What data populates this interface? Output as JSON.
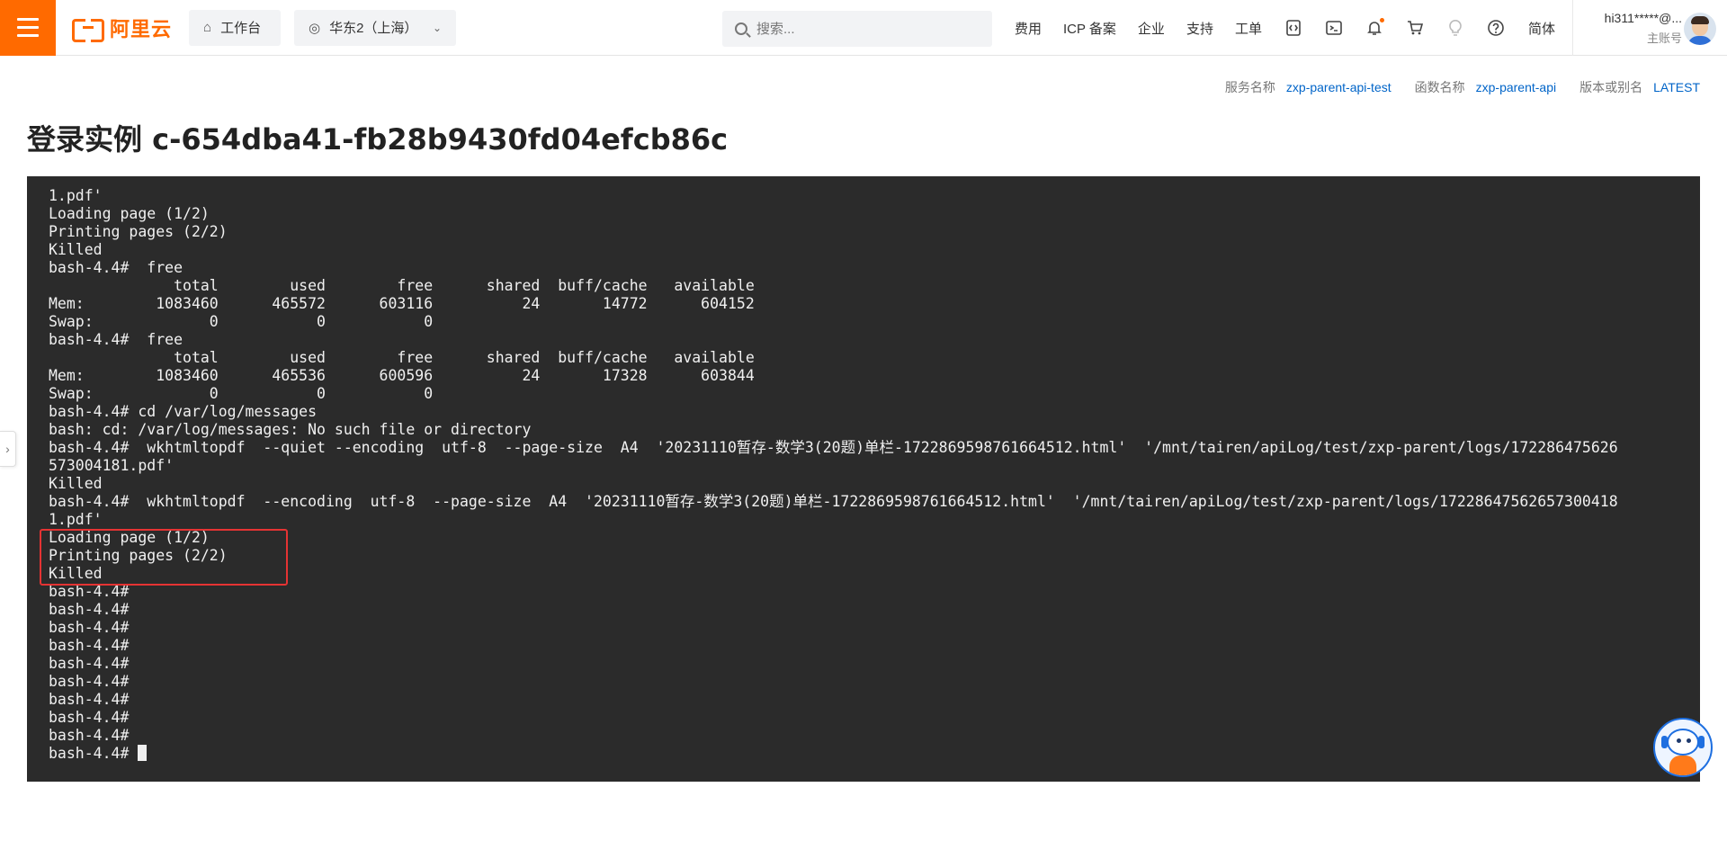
{
  "topbar": {
    "logo_text": "阿里云",
    "workbench_label": "工作台",
    "region_label": "华东2（上海）",
    "search_placeholder": "搜索...",
    "links": [
      "费用",
      "ICP 备案",
      "企业",
      "支持",
      "工单"
    ],
    "icons": [
      "code-icon",
      "terminal-icon",
      "bell-icon",
      "cart-icon",
      "lightbulb-icon",
      "help-icon"
    ],
    "language": "简体",
    "account_email": "hi311*****@...",
    "account_role": "主账号",
    "accent_color": "#ff6a00"
  },
  "meta": {
    "service_label": "服务名称",
    "service_value": "zxp-parent-api-test",
    "function_label": "函数名称",
    "function_value": "zxp-parent-api",
    "version_label": "版本或别名",
    "version_value": "LATEST"
  },
  "page_title": "登录实例 c-654dba41-fb28b9430fd04efcb86c",
  "terminal": {
    "lines": [
      "1.pdf'",
      "Loading page (1/2)",
      "Printing pages (2/2)",
      "Killed",
      "bash-4.4#  free",
      "              total        used        free      shared  buff/cache   available",
      "Mem:        1083460      465572      603116          24       14772      604152",
      "Swap:             0           0           0",
      "bash-4.4#  free",
      "              total        used        free      shared  buff/cache   available",
      "Mem:        1083460      465536      600596          24       17328      603844",
      "Swap:             0           0           0",
      "bash-4.4# cd /var/log/messages",
      "bash: cd: /var/log/messages: No such file or directory",
      "bash-4.4#  wkhtmltopdf  --quiet --encoding  utf-8  --page-size  A4  '20231110暂存-数学3(20题)单栏-172286959876166451​2.html'  '/mnt/tairen/apiLog/test/zxp-parent/logs/172286475626",
      "573004181.pdf'",
      "Killed",
      "bash-4.4#  wkhtmltopdf  --encoding  utf-8  --page-size  A4  '20231110暂存-数学3(20题)单栏-1722869598761664512.html'  '/mnt/tairen/apiLog/test/zxp-parent/logs/17228647562657300418",
      "1.pdf'",
      "Loading page (1/2)",
      "Printing pages (2/2)",
      "Killed",
      "bash-4.4#",
      "bash-4.4#",
      "bash-4.4#",
      "bash-4.4#",
      "bash-4.4#",
      "bash-4.4#",
      "bash-4.4#",
      "bash-4.4#",
      "bash-4.4#",
      "bash-4.4#"
    ],
    "background": "#2b2b2b",
    "highlight_color": "#e53333"
  }
}
